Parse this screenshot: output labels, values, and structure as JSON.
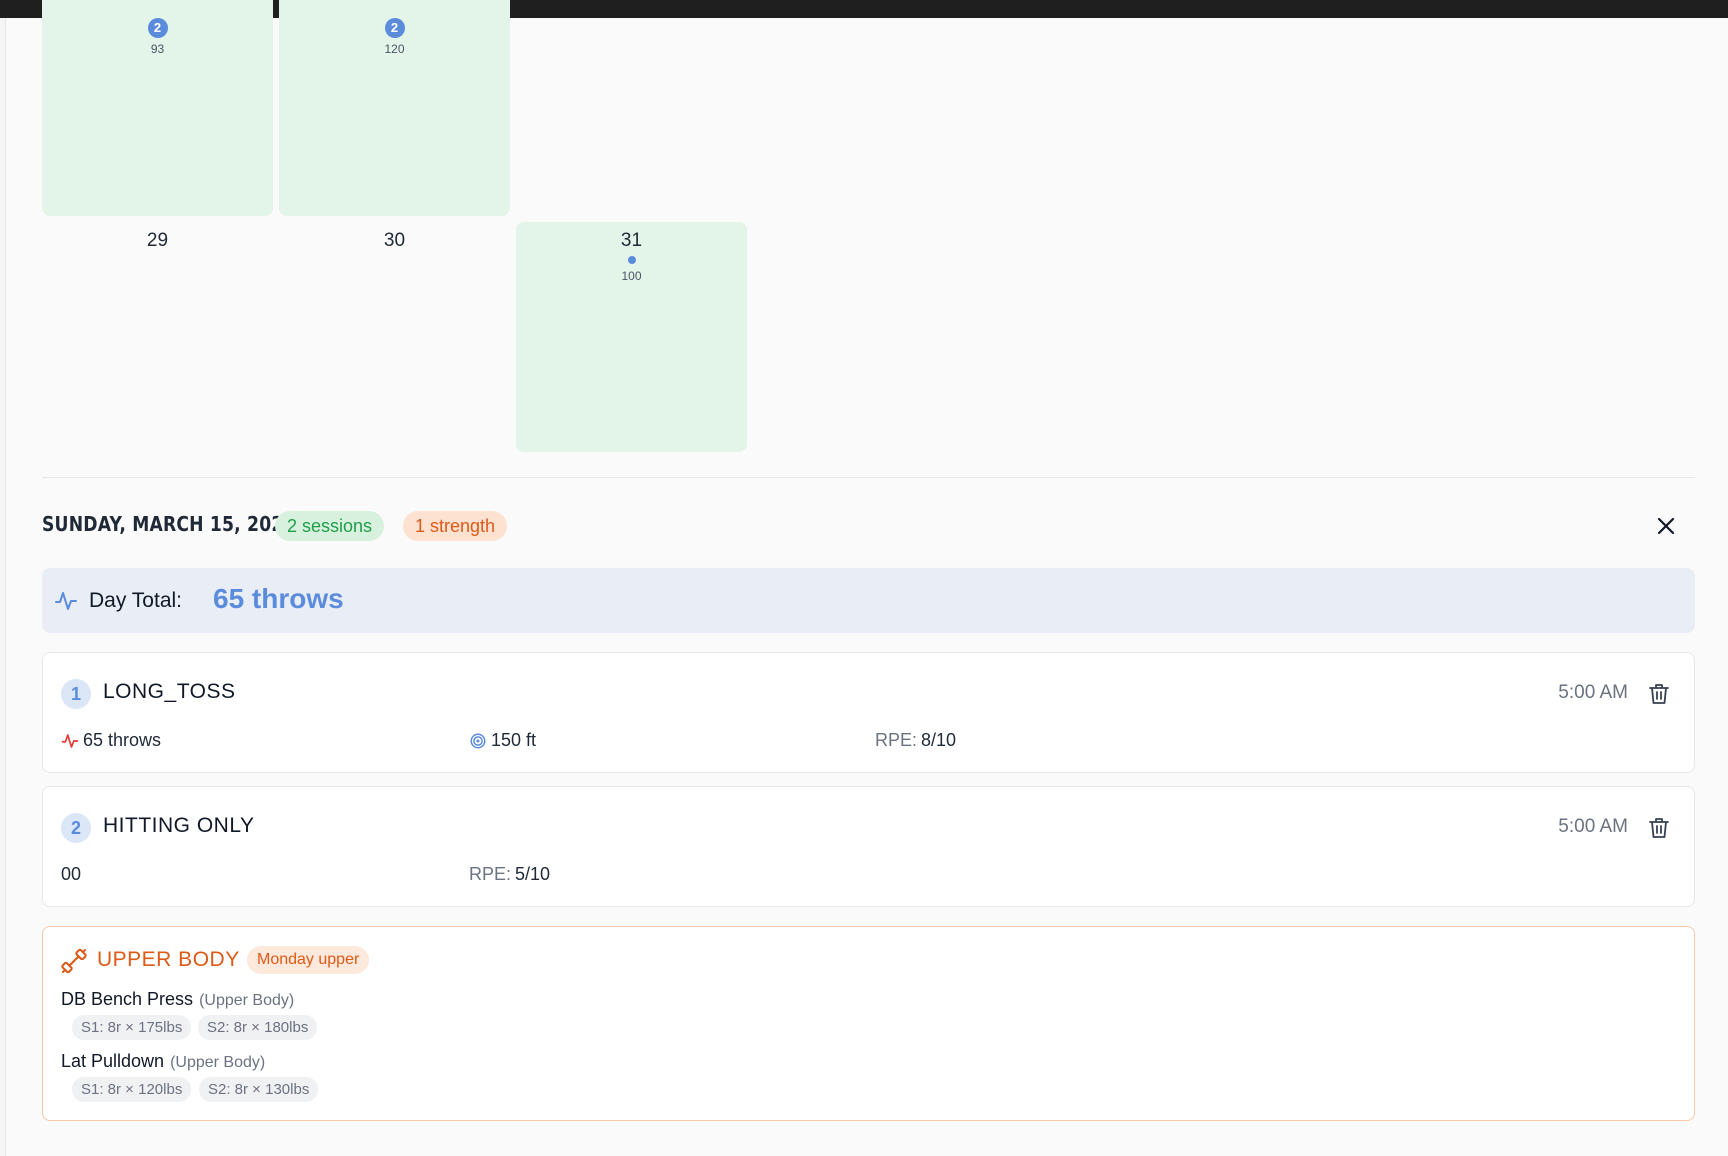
{
  "calendar": {
    "cells": [
      {
        "day": "",
        "badge": "2",
        "count": "93",
        "active": true
      },
      {
        "day": "",
        "badge": "2",
        "count": "120",
        "active": true
      },
      {
        "day": "29",
        "count": "",
        "active": false
      },
      {
        "day": "30",
        "count": "",
        "active": false
      },
      {
        "day": "31",
        "count": "100",
        "active": true,
        "dot": true
      }
    ]
  },
  "detail": {
    "date_title": "SUNDAY, MARCH 15, 2026",
    "sessions_pill": "2 sessions",
    "strength_pill": "1 strength",
    "day_total_label": "Day Total:",
    "day_total_value": "65 throws"
  },
  "sessions": [
    {
      "number": "1",
      "name": "LONG_TOSS",
      "time": "5:00 AM",
      "throws": "65 throws",
      "distance": "150 ft",
      "rpe_label": "RPE:",
      "rpe": "8/10"
    },
    {
      "number": "2",
      "name": "HITTING ONLY",
      "time": "5:00 AM",
      "value": "00",
      "rpe_label": "RPE:",
      "rpe": "5/10"
    }
  ],
  "strength": {
    "title": "UPPER BODY",
    "tag": "Monday upper",
    "exercises": [
      {
        "name": "DB Bench Press",
        "category": "(Upper Body)",
        "sets": [
          "S1: 8r × 175lbs",
          "S2: 8r × 180lbs"
        ]
      },
      {
        "name": "Lat Pulldown",
        "category": "(Upper Body)",
        "sets": [
          "S1: 8r × 120lbs",
          "S2: 8r × 130lbs"
        ]
      }
    ]
  },
  "colors": {
    "accent_blue": "#5b8cdb",
    "active_day": "#e3f4e8",
    "strength_orange": "#dd5a17",
    "sessions_green": "#1e9e48"
  }
}
